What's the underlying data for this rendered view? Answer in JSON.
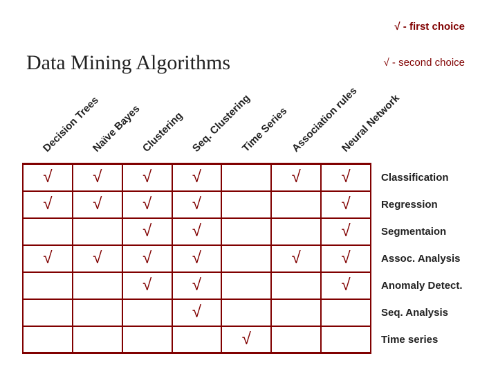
{
  "legend": {
    "first": "√ - first choice",
    "second": "√ - second choice"
  },
  "title": "Data Mining Algorithms",
  "columns": [
    "Decision Trees",
    "Naïve Bayes",
    "Clustering",
    "Seq. Clustering",
    "Time Series",
    "Association rules",
    "Neural Network"
  ],
  "rows": [
    "Classification",
    "Regression",
    "Segmentaion",
    "Assoc. Analysis",
    "Anomaly Detect.",
    "Seq. Analysis",
    "Time series"
  ],
  "mark": "√",
  "chart_data": {
    "type": "table",
    "title": "Data Mining Algorithms",
    "xlabel": "",
    "ylabel": "",
    "categories": [
      "Decision Trees",
      "Naïve Bayes",
      "Clustering",
      "Seq. Clustering",
      "Time Series",
      "Association rules",
      "Neural Network"
    ],
    "row_labels": [
      "Classification",
      "Regression",
      "Segmentaion",
      "Assoc. Analysis",
      "Anomaly Detect.",
      "Seq. Analysis",
      "Time series"
    ],
    "matrix": [
      [
        1,
        1,
        1,
        1,
        0,
        1,
        1
      ],
      [
        1,
        1,
        1,
        1,
        0,
        0,
        1
      ],
      [
        0,
        0,
        1,
        1,
        0,
        0,
        1
      ],
      [
        1,
        1,
        1,
        1,
        0,
        1,
        1
      ],
      [
        0,
        0,
        1,
        1,
        0,
        0,
        1
      ],
      [
        0,
        0,
        0,
        1,
        0,
        0,
        0
      ],
      [
        0,
        0,
        0,
        0,
        1,
        0,
        0
      ]
    ],
    "legend": [
      "√ - first choice",
      "√ - second choice"
    ]
  }
}
